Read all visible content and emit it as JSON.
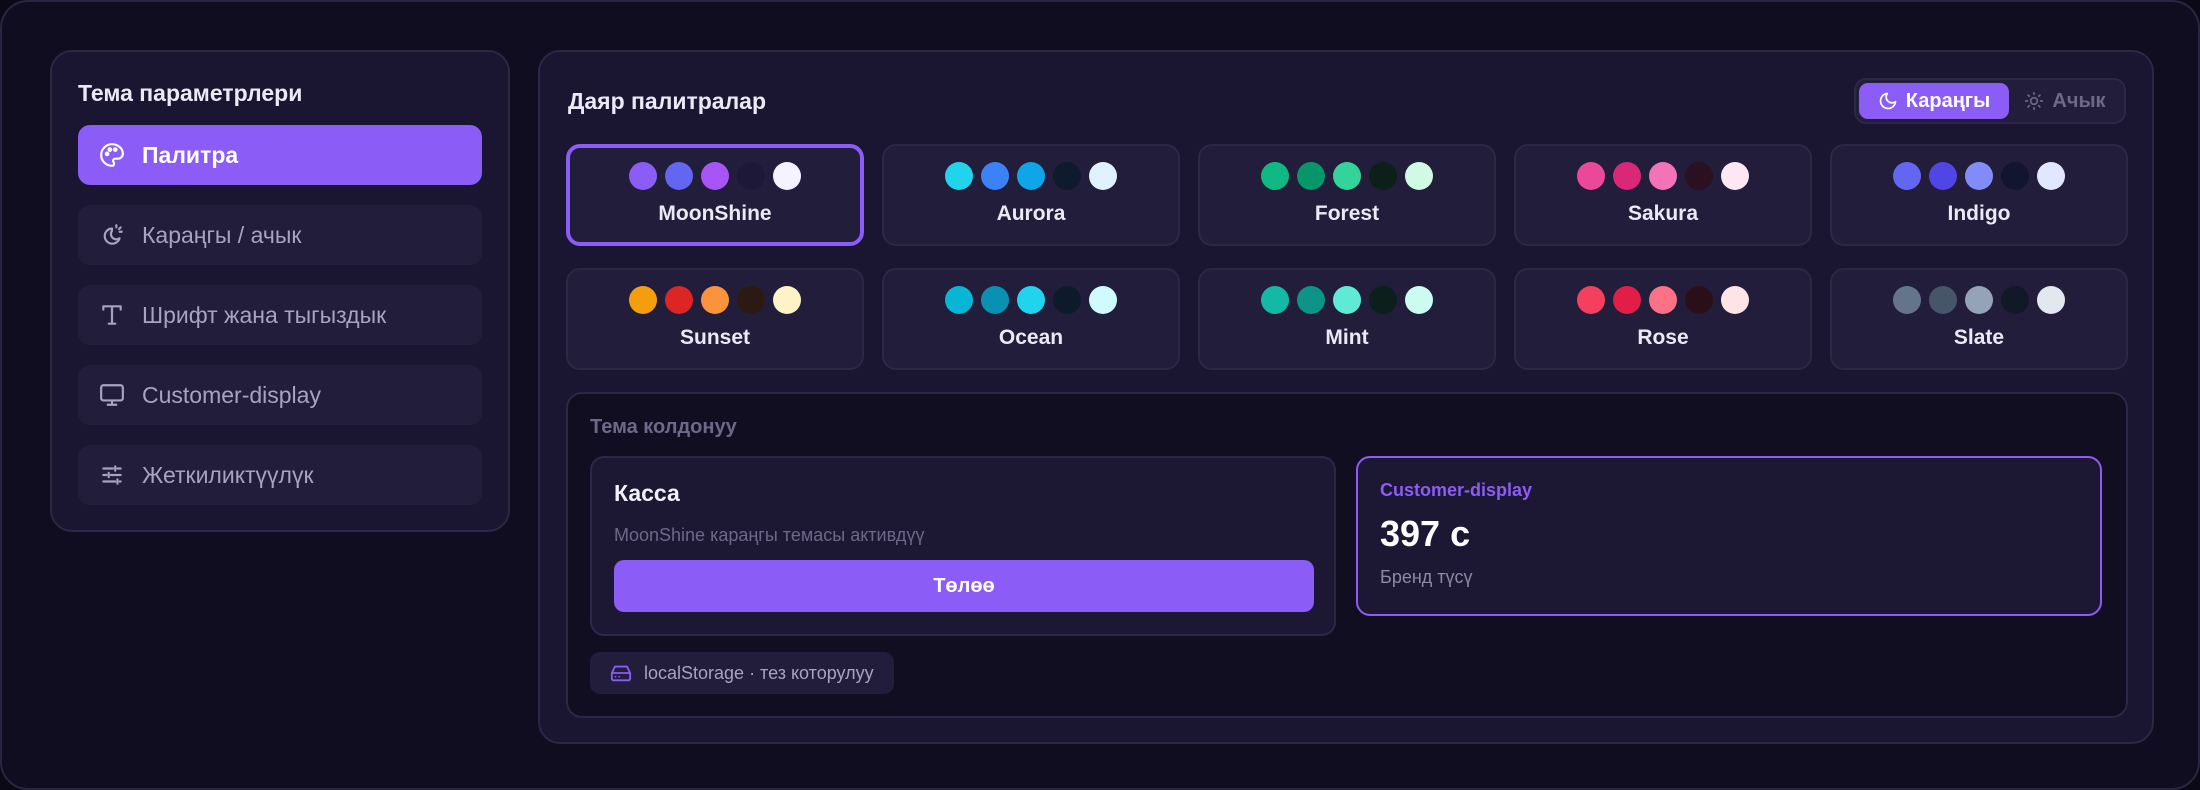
{
  "sidebar": {
    "title": "Тема параметрлери",
    "items": [
      {
        "label": "Палитра",
        "icon": "palette-icon",
        "active": true
      },
      {
        "label": "Караңгы / ачык",
        "icon": "theme-toggle-icon",
        "active": false
      },
      {
        "label": "Шрифт жана тыгыздык",
        "icon": "type-icon",
        "active": false
      },
      {
        "label": "Customer-display",
        "icon": "monitor-icon",
        "active": false
      },
      {
        "label": "Жеткиликтүүлүк",
        "icon": "sliders-icon",
        "active": false
      }
    ]
  },
  "main": {
    "title": "Даяр палитралар",
    "mode": {
      "dark_label": "Караңгы",
      "light_label": "Ачык",
      "selected": "dark"
    },
    "palettes": [
      {
        "name": "MoonShine",
        "selected": true,
        "colors": [
          "#8b5cf6",
          "#6366f1",
          "#a855f7",
          "#1e1838",
          "#f5f3ff"
        ]
      },
      {
        "name": "Aurora",
        "selected": false,
        "colors": [
          "#22d3ee",
          "#3b82f6",
          "#0ea5e9",
          "#0f1a2e",
          "#e0f2fe"
        ]
      },
      {
        "name": "Forest",
        "selected": false,
        "colors": [
          "#10b981",
          "#059669",
          "#34d399",
          "#0c1f18",
          "#d1fae5"
        ]
      },
      {
        "name": "Sakura",
        "selected": false,
        "colors": [
          "#ec4899",
          "#db2777",
          "#f472b6",
          "#2a1020",
          "#fce7f3"
        ]
      },
      {
        "name": "Indigo",
        "selected": false,
        "colors": [
          "#6366f1",
          "#4f46e5",
          "#818cf8",
          "#121530",
          "#e0e7ff"
        ]
      },
      {
        "name": "Sunset",
        "selected": false,
        "colors": [
          "#f59e0b",
          "#dc2626",
          "#fb923c",
          "#2b1a12",
          "#fef3c7"
        ]
      },
      {
        "name": "Ocean",
        "selected": false,
        "colors": [
          "#06b6d4",
          "#0891b2",
          "#22d3ee",
          "#0c1a2a",
          "#cffafe"
        ]
      },
      {
        "name": "Mint",
        "selected": false,
        "colors": [
          "#14b8a6",
          "#0d9488",
          "#5eead4",
          "#0c1f1c",
          "#ccfbf1"
        ]
      },
      {
        "name": "Rose",
        "selected": false,
        "colors": [
          "#f43f5e",
          "#e11d48",
          "#fb7185",
          "#2a0f18",
          "#ffe4e6"
        ]
      },
      {
        "name": "Slate",
        "selected": false,
        "colors": [
          "#64748b",
          "#475569",
          "#94a3b8",
          "#111827",
          "#e2e8f0"
        ]
      }
    ],
    "usage": {
      "title": "Тема колдонуу",
      "cashier": {
        "title": "Касса",
        "description": "MoonShine караңгы темасы активдүү",
        "pay_label": "Төлөө"
      },
      "customer_display": {
        "label": "Customer-display",
        "amount": "397 с",
        "subtitle": "Бренд түсү"
      },
      "storage": {
        "label": "localStorage · тез которулуу",
        "icon": "storage-icon"
      }
    }
  },
  "colors": {
    "accent": "#8b5cf6",
    "background": "#110d20",
    "panel": "#1a1530"
  }
}
